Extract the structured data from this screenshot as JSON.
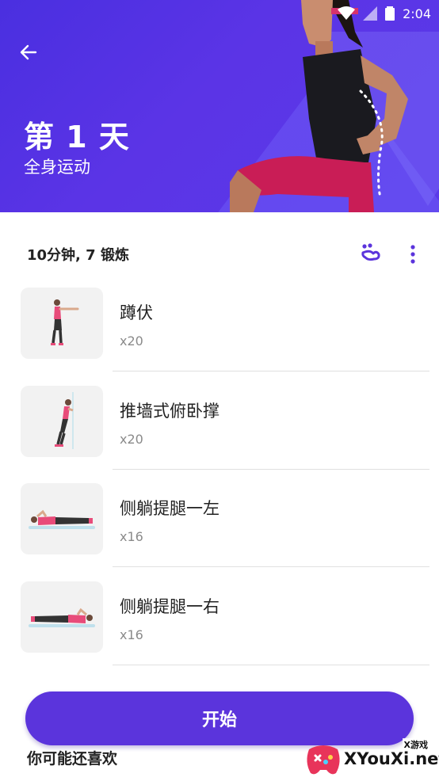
{
  "status_bar": {
    "time": "2:04"
  },
  "header": {
    "title": "第 1 天",
    "subtitle": "全身运动"
  },
  "summary": {
    "text": "10分钟, 7 锻炼"
  },
  "exercises": [
    {
      "name": "蹲伏",
      "reps": "x20"
    },
    {
      "name": "推墙式俯卧撑",
      "reps": "x20"
    },
    {
      "name": "侧躺提腿一左",
      "reps": "x16"
    },
    {
      "name": "侧躺提腿一右",
      "reps": "x16"
    }
  ],
  "start_button": {
    "label": "开始"
  },
  "recommend": {
    "title": "你可能还喜欢"
  },
  "watermark": {
    "text": "XYouXi.net",
    "tag": "X游戏"
  },
  "colors": {
    "primary": "#5b34dc",
    "hero": "#4a2fe0",
    "accent_pink": "#d6336c"
  }
}
